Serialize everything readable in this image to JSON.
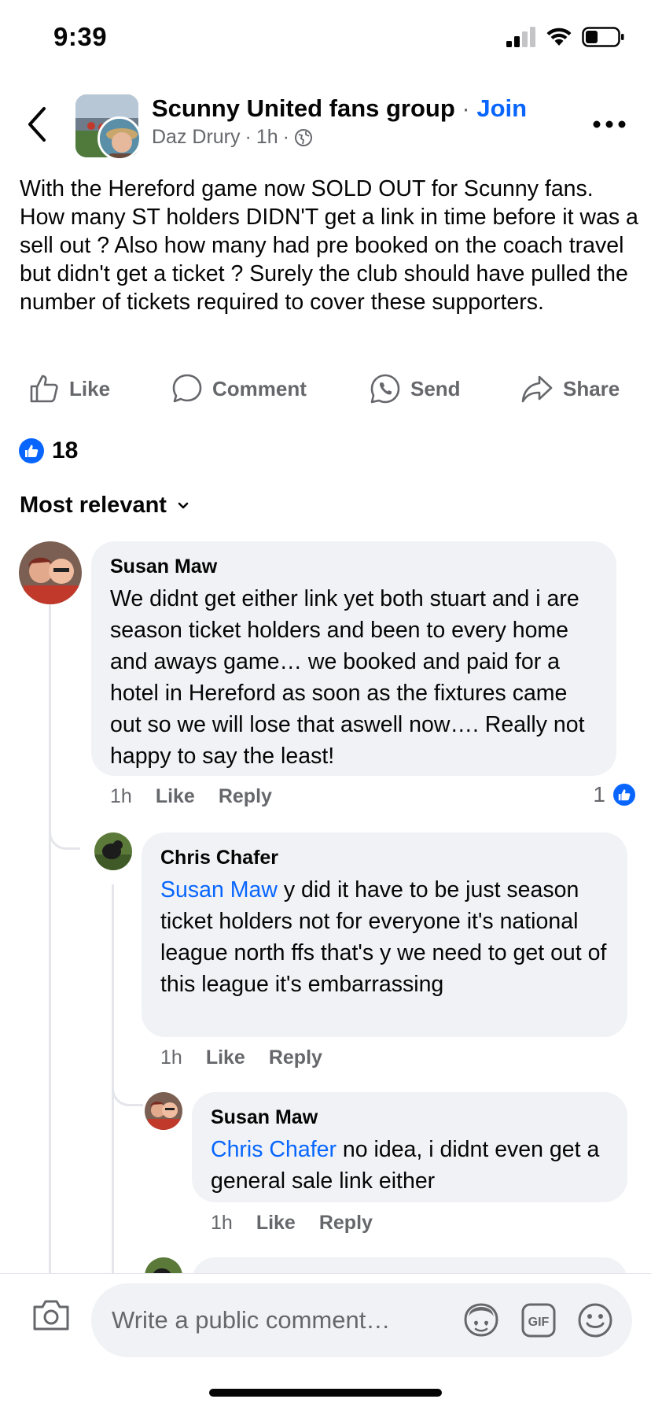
{
  "status": {
    "time": "9:39"
  },
  "header": {
    "group_name": "Scunny United fans group",
    "separator": "·",
    "join_label": "Join",
    "author": "Daz Drury",
    "meta_dot": "·",
    "time": "1h",
    "meta_dot2": "·"
  },
  "post": {
    "text": "With the Hereford game now SOLD OUT for Scunny fans. How many ST holders DIDN'T  get a link in time before it was a sell out ? Also how many had pre booked on the coach travel but didn't get a ticket ? Surely the club should have pulled the number of tickets required to cover these supporters."
  },
  "actions": {
    "like": "Like",
    "comment": "Comment",
    "send": "Send",
    "share": "Share"
  },
  "reactions": {
    "count": "18"
  },
  "sort": {
    "label": "Most relevant"
  },
  "comments": [
    {
      "author": "Susan Maw",
      "mention": "",
      "text": "We didnt get either link yet both stuart and i are season ticket holders and been to every home and aways game… we booked and paid for a hotel in Hereford as soon as the fixtures came out so we will lose that aswell now…. Really not happy to say the least!",
      "time": "1h",
      "like_label": "Like",
      "reply_label": "Reply",
      "like_count": "1"
    },
    {
      "author": "Chris Chafer",
      "mention": "Susan Maw",
      "text": " y did it have to be just season ticket holders not for everyone it's national league north ffs that's y we need to get out  of this league it's embarrassing",
      "time": "1h",
      "like_label": "Like",
      "reply_label": "Reply"
    },
    {
      "author": "Susan Maw",
      "mention": "Chris Chafer",
      "text": " no idea, i didnt even get a general sale link either",
      "time": "1h",
      "like_label": "Like",
      "reply_label": "Reply"
    }
  ],
  "composer": {
    "placeholder": "Write a public comment…"
  },
  "colors": {
    "accent": "#0866ff",
    "bubble": "#f0f2f5",
    "secondary_text": "#65676b"
  }
}
